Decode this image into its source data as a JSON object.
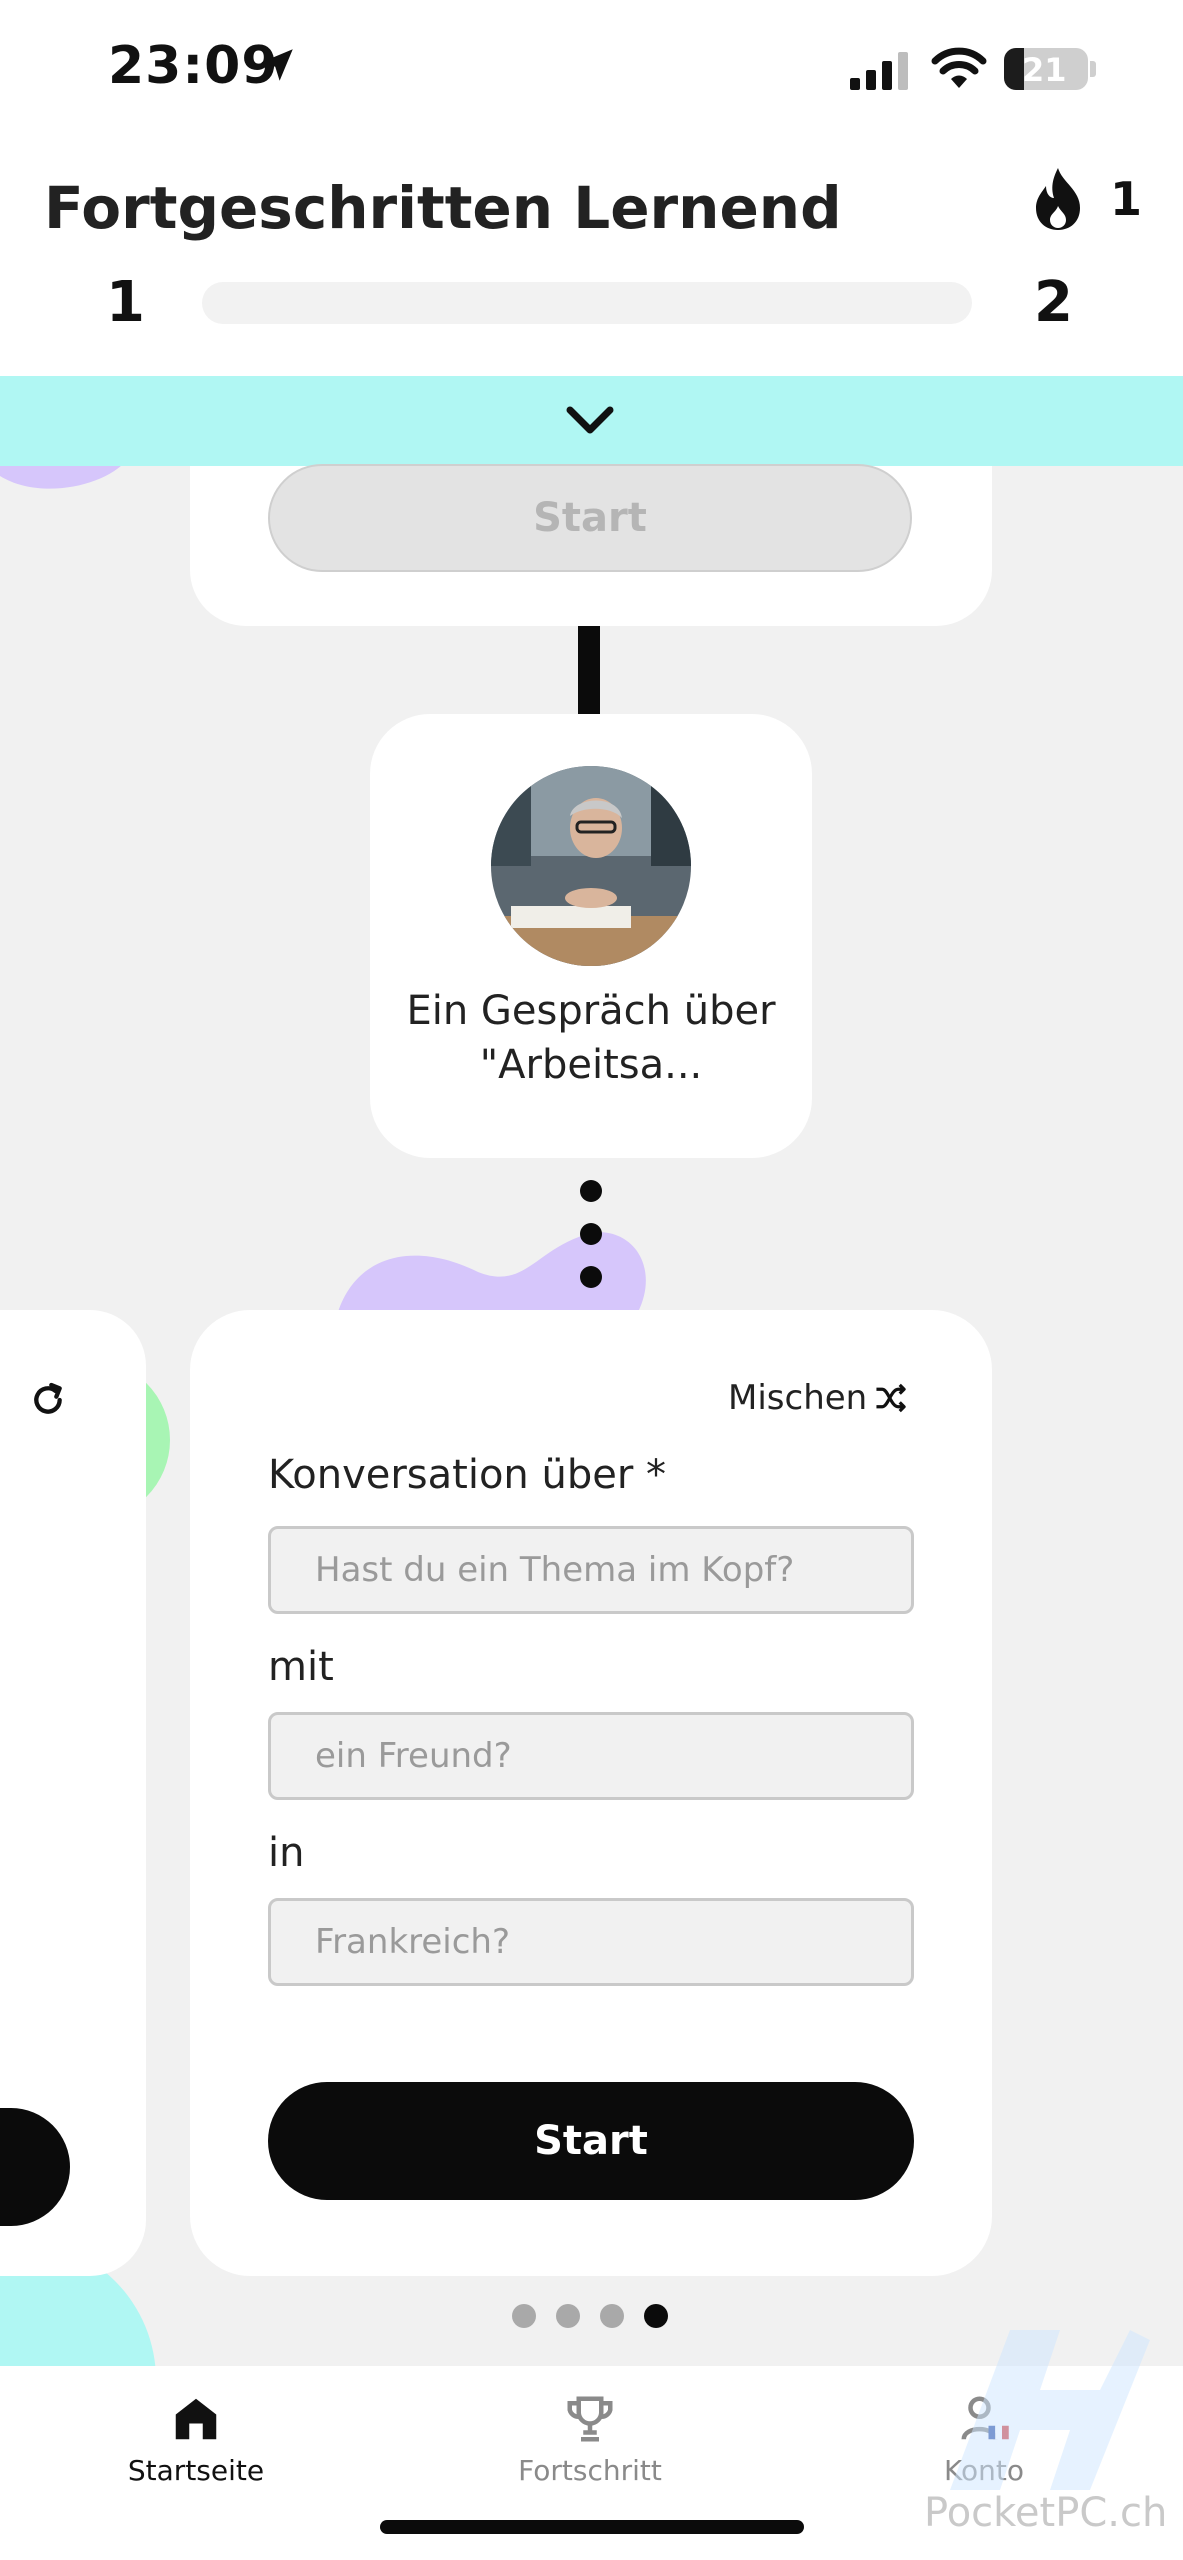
{
  "status_bar": {
    "time": "23:09",
    "battery": "21"
  },
  "header": {
    "title": "Fortgeschritten Lernend",
    "streak": "1",
    "level_current": "1",
    "level_next": "2",
    "progress": 0
  },
  "previous_card": {
    "start_label": "Start"
  },
  "lesson": {
    "title": "Ein Gespräch über \"Arbeitsa..."
  },
  "custom_card": {
    "shuffle_label": "Mischen",
    "topic_label": "Konversation über *",
    "topic_placeholder": "Hast du ein Thema im Kopf?",
    "with_label": "mit",
    "with_placeholder": "ein Freund?",
    "in_label": "in",
    "in_placeholder": "Frankreich?",
    "start_label": "Start"
  },
  "pager": {
    "count": 4,
    "active": 4
  },
  "nav": {
    "home_label": "Startseite",
    "progress_label": "Fortschritt",
    "account_label": "Konto"
  },
  "watermark": "PocketPC.ch",
  "colors": {
    "accent_bar": "#b0f7f3",
    "blob_purple": "#d6c6fb",
    "blob_green": "#a8f5b4",
    "blob_cyan": "#b0f7f3",
    "primary": "#0b0b0b"
  }
}
